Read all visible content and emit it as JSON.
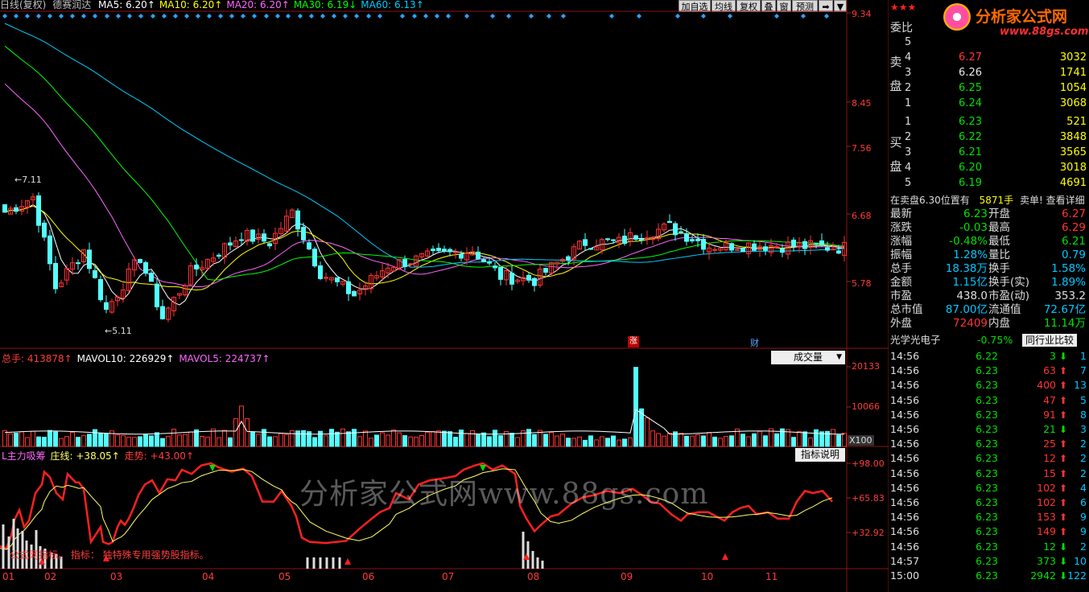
{
  "header": {
    "chart_mode": "日线(复权)",
    "stock_name": "德赛润达",
    "ma": [
      {
        "label": "MA5: 6.20↑",
        "color": "#ffffff"
      },
      {
        "label": "MA10: 6.20↑",
        "color": "#ffff00"
      },
      {
        "label": "MA20: 6.20↑",
        "color": "#ff66ff"
      },
      {
        "label": "MA30: 6.19↓",
        "color": "#00ff00"
      },
      {
        "label": "MA60: 6.13↑",
        "color": "#00ccff"
      }
    ],
    "buttons": [
      "加自选",
      "均线",
      "复权",
      "叠",
      "窗",
      "预测"
    ]
  },
  "price_axis": [
    "9.34",
    "8.45",
    "7.56",
    "6.68",
    "5.78"
  ],
  "price_annotations": {
    "high": "7.11",
    "low": "5.11"
  },
  "event_markers": [
    "涨",
    "财"
  ],
  "volume_panel": {
    "total": "总手: 413878↑",
    "mavol10": "MAVOL10: 226929↑",
    "mavol5": "MAVOL5: 224737↑",
    "dropdown": "成交量",
    "axis": [
      "20133",
      "10066"
    ],
    "unit": "X100"
  },
  "indicator_panel": {
    "name": "L主力吸筹",
    "zhuangxian": "庄线: +38.05↑",
    "zoushi": "走势: +43.00↑",
    "button": "指标说明",
    "axis": [
      "+98.00",
      "+65.83",
      "+32.92"
    ],
    "note": "公式网指标。 指标：  独特殊专用强势股指标。"
  },
  "watermark": "分析家公式网www.88gs.com",
  "x_axis": [
    "01",
    "02",
    "03",
    "04",
    "05",
    "06",
    "07",
    "08",
    "09",
    "10",
    "11"
  ],
  "logo": {
    "title": "分析家公式网",
    "url": "www.88gs.com"
  },
  "order_book": {
    "ratio_label": "委比",
    "sell_label": "卖盘",
    "buy_label": "买盘",
    "sells": [
      {
        "lvl": "5",
        "price": "",
        "vol": ""
      },
      {
        "lvl": "4",
        "price": "6.27",
        "vol": "3032"
      },
      {
        "lvl": "3",
        "price": "6.26",
        "vol": "1741"
      },
      {
        "lvl": "2",
        "price": "6.25",
        "vol": "1054"
      },
      {
        "lvl": "1",
        "price": "6.24",
        "vol": "3068"
      }
    ],
    "buys": [
      {
        "lvl": "1",
        "price": "6.23",
        "vol": "521"
      },
      {
        "lvl": "2",
        "price": "6.22",
        "vol": "3848"
      },
      {
        "lvl": "3",
        "price": "6.21",
        "vol": "3565"
      },
      {
        "lvl": "4",
        "price": "6.20",
        "vol": "3018"
      },
      {
        "lvl": "5",
        "price": "6.19",
        "vol": "4691"
      }
    ],
    "notice": {
      "left": "在卖盘6.30位置有",
      "mid": "5871手",
      "right": "卖单! 查看详细"
    }
  },
  "quote": [
    {
      "l1": "最新",
      "v1": "6.23",
      "c1": "#00e000",
      "l2": "开盘",
      "v2": "6.27",
      "c2": "#ff3333"
    },
    {
      "l1": "涨跌",
      "v1": "-0.03",
      "c1": "#00e000",
      "l2": "最高",
      "v2": "6.29",
      "c2": "#ff3333"
    },
    {
      "l1": "涨幅",
      "v1": "-0.48%",
      "c1": "#00e000",
      "l2": "最低",
      "v2": "6.21",
      "c2": "#00e000"
    },
    {
      "l1": "振幅",
      "v1": "1.28%",
      "c1": "#00c8ff",
      "l2": "量比",
      "v2": "0.79",
      "c2": "#00c8ff"
    },
    {
      "l1": "总手",
      "v1": "18.38万",
      "c1": "#00c8ff",
      "l2": "换手",
      "v2": "1.58%",
      "c2": "#00c8ff"
    },
    {
      "l1": "金额",
      "v1": "1.15亿",
      "c1": "#00c8ff",
      "l2": "换手(实)",
      "v2": "1.89%",
      "c2": "#00c8ff"
    },
    {
      "l1": "市盈",
      "v1": "438.0",
      "c1": "#e0e0e0",
      "l2": "市盈(动)",
      "v2": "353.2",
      "c2": "#e0e0e0"
    },
    {
      "l1": "总市值",
      "v1": "87.00亿",
      "c1": "#00c8ff",
      "l2": "流通值",
      "v2": "72.67亿",
      "c2": "#00c8ff"
    },
    {
      "l1": "外盘",
      "v1": "72409",
      "c1": "#ff3333",
      "l2": "内盘",
      "v2": "11.14万",
      "c2": "#00e000"
    }
  ],
  "sector": {
    "name": "光学光电子",
    "change": "-0.75%",
    "button": "同行业比较"
  },
  "ticks": [
    {
      "t": "14:56",
      "p": "6.22",
      "v": "3",
      "up": false,
      "x": "1"
    },
    {
      "t": "14:56",
      "p": "6.23",
      "v": "63",
      "up": true,
      "x": "7"
    },
    {
      "t": "14:56",
      "p": "6.23",
      "v": "400",
      "up": true,
      "x": "13"
    },
    {
      "t": "14:56",
      "p": "6.23",
      "v": "47",
      "up": true,
      "x": "5"
    },
    {
      "t": "14:56",
      "p": "6.23",
      "v": "91",
      "up": true,
      "x": "8"
    },
    {
      "t": "14:56",
      "p": "6.23",
      "v": "21",
      "up": false,
      "x": "3"
    },
    {
      "t": "14:56",
      "p": "6.23",
      "v": "25",
      "up": true,
      "x": "2"
    },
    {
      "t": "14:56",
      "p": "6.23",
      "v": "12",
      "up": true,
      "x": "2"
    },
    {
      "t": "14:56",
      "p": "6.23",
      "v": "15",
      "up": true,
      "x": "2"
    },
    {
      "t": "14:56",
      "p": "6.23",
      "v": "102",
      "up": true,
      "x": "4"
    },
    {
      "t": "14:56",
      "p": "6.23",
      "v": "102",
      "up": true,
      "x": "6"
    },
    {
      "t": "14:56",
      "p": "6.23",
      "v": "153",
      "up": true,
      "x": "9"
    },
    {
      "t": "14:56",
      "p": "6.23",
      "v": "149",
      "up": true,
      "x": "9"
    },
    {
      "t": "14:56",
      "p": "6.23",
      "v": "12",
      "up": false,
      "x": "2"
    },
    {
      "t": "14:57",
      "p": "6.23",
      "v": "373",
      "up": false,
      "x": "10"
    },
    {
      "t": "15:00",
      "p": "6.23",
      "v": "2942",
      "up": false,
      "x": "122"
    }
  ]
}
